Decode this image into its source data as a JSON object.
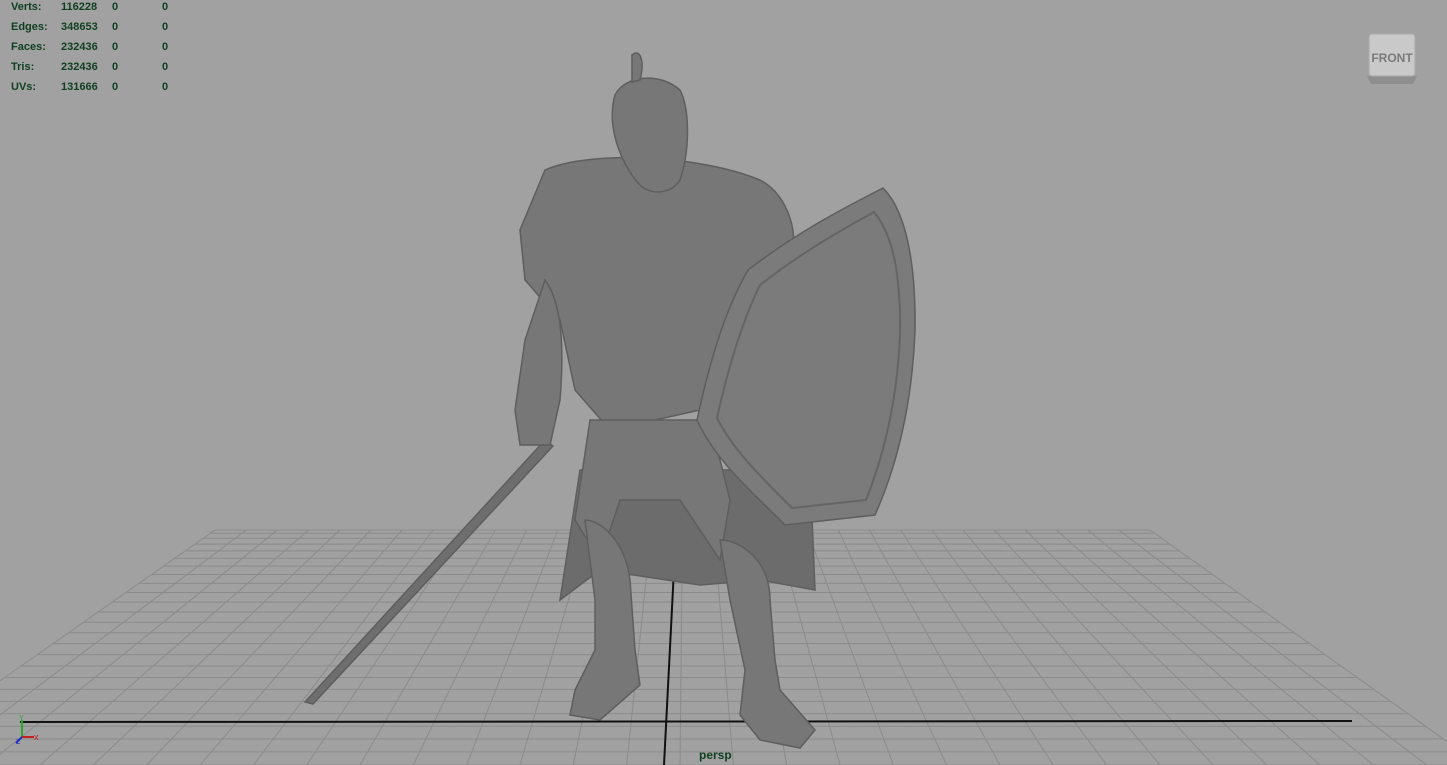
{
  "hud": {
    "rows": [
      {
        "label": "Verts:",
        "total": "116228",
        "selected": "0",
        "components": "0"
      },
      {
        "label": "Edges:",
        "total": "348653",
        "selected": "0",
        "components": "0"
      },
      {
        "label": "Faces:",
        "total": "232436",
        "selected": "0",
        "components": "0"
      },
      {
        "label": "Tris:",
        "total": "232436",
        "selected": "0",
        "components": "0"
      },
      {
        "label": "UVs:",
        "total": "131666",
        "selected": "0",
        "components": "0"
      }
    ]
  },
  "viewcube": {
    "face_label": "FRONT"
  },
  "camera": {
    "name": "persp"
  },
  "axis_indicator": {
    "y": "Y",
    "z": "z",
    "x": "x"
  },
  "colors": {
    "viewport_bg": "#a1a1a1",
    "hud_text": "#0f3f20",
    "grid_line": "#8a8a8a",
    "model": "#767676"
  }
}
